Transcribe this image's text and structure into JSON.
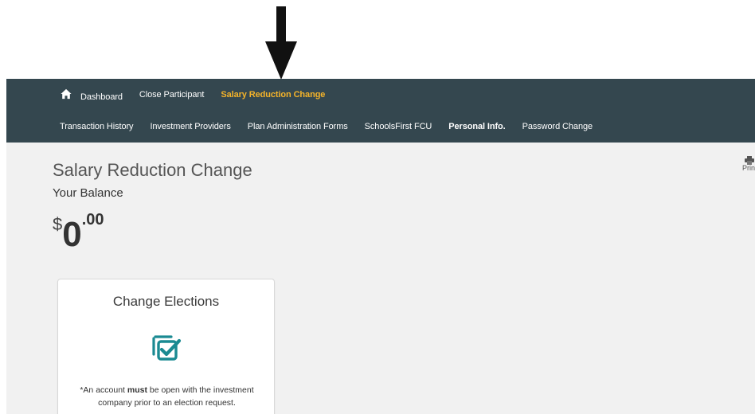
{
  "nav": {
    "row1": [
      {
        "label": "Dashboard",
        "icon": "home-icon"
      },
      {
        "label": "Close Participant"
      },
      {
        "label": "Salary Reduction Change",
        "active": true
      }
    ],
    "row2": [
      {
        "label": "Transaction History"
      },
      {
        "label": "Investment Providers"
      },
      {
        "label": "Plan Administration Forms"
      },
      {
        "label": "SchoolsFirst FCU"
      },
      {
        "label": "Personal Info.",
        "bold": true
      },
      {
        "label": "Password Change"
      }
    ]
  },
  "page": {
    "title": "Salary Reduction Change",
    "balance_label": "Your Balance",
    "balance": {
      "currency": "$",
      "whole": "0",
      "cents": ".00"
    },
    "print_label": "Prin"
  },
  "card": {
    "title": "Change Elections",
    "icon": "checkbox-check-icon",
    "note_prefix": "*An account ",
    "note_bold": "must",
    "note_suffix": " be open with the investment company prior to an election request."
  },
  "colors": {
    "nav_bg": "#34474f",
    "active_nav": "#f4b32a",
    "icon_teal": "#1a8a92",
    "page_bg": "#f1f1f1"
  }
}
